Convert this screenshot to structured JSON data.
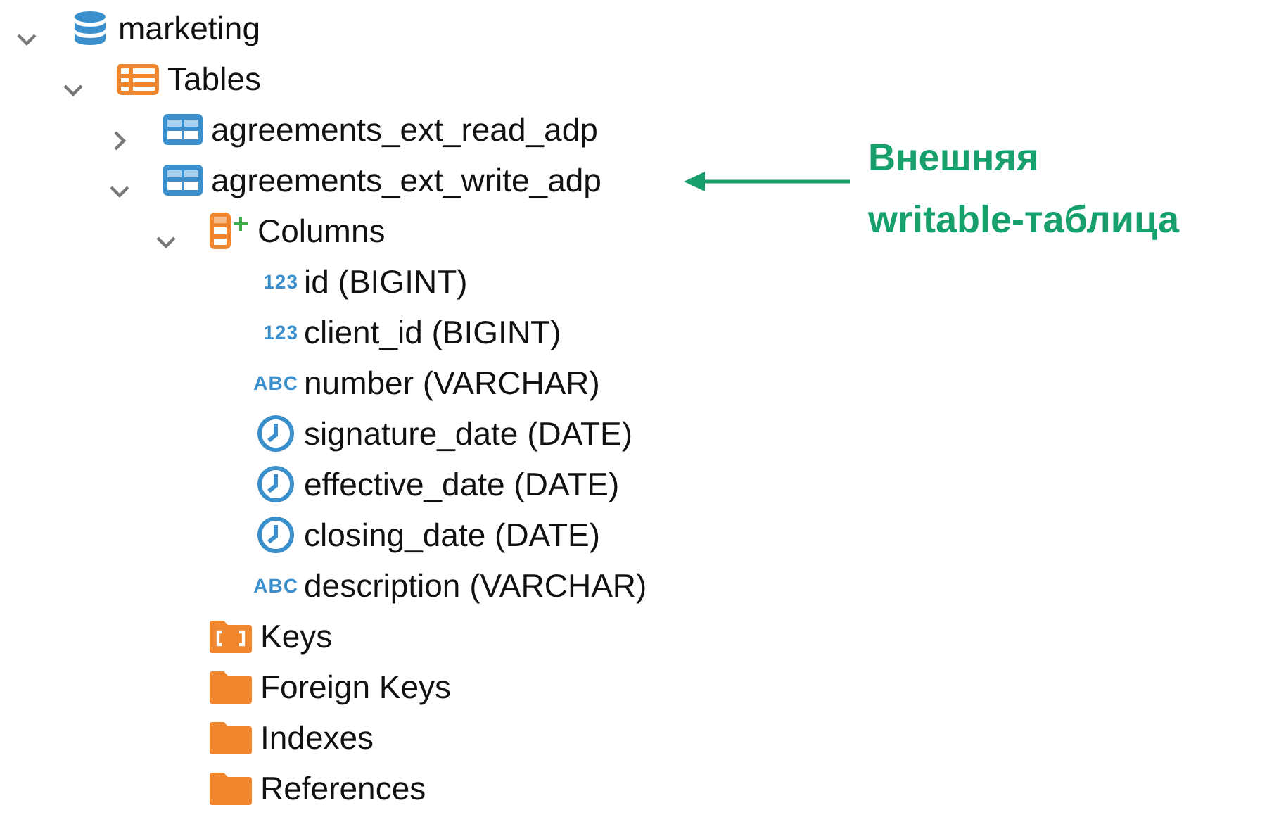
{
  "tree": [
    {
      "label": "marketing",
      "kind": "database",
      "expanded": true,
      "children": [
        {
          "label": "Tables",
          "kind": "tables",
          "expanded": true,
          "children": [
            {
              "label": "agreements_ext_read_adp",
              "kind": "table",
              "expanded": false
            },
            {
              "label": "agreements_ext_write_adp",
              "kind": "table",
              "expanded": true,
              "children": [
                {
                  "label": "Columns",
                  "kind": "columns",
                  "expanded": true,
                  "children": [
                    {
                      "label": "id (BIGINT)",
                      "kind": "typed",
                      "type_label": "123"
                    },
                    {
                      "label": "client_id (BIGINT)",
                      "kind": "typed",
                      "type_label": "123"
                    },
                    {
                      "label": "number (VARCHAR)",
                      "kind": "typed",
                      "type_label": "ABC"
                    },
                    {
                      "label": "signature_date (DATE)",
                      "kind": "date"
                    },
                    {
                      "label": "effective_date (DATE)",
                      "kind": "date"
                    },
                    {
                      "label": "closing_date (DATE)",
                      "kind": "date"
                    },
                    {
                      "label": "description (VARCHAR)",
                      "kind": "typed",
                      "type_label": "ABC"
                    }
                  ]
                },
                {
                  "label": "Keys",
                  "kind": "keys"
                },
                {
                  "label": "Foreign Keys",
                  "kind": "folder"
                },
                {
                  "label": "Indexes",
                  "kind": "folder"
                },
                {
                  "label": "References",
                  "kind": "folder"
                }
              ]
            }
          ]
        }
      ]
    }
  ],
  "callout": {
    "lines": [
      "Внешняя",
      "writable-таблица"
    ]
  }
}
